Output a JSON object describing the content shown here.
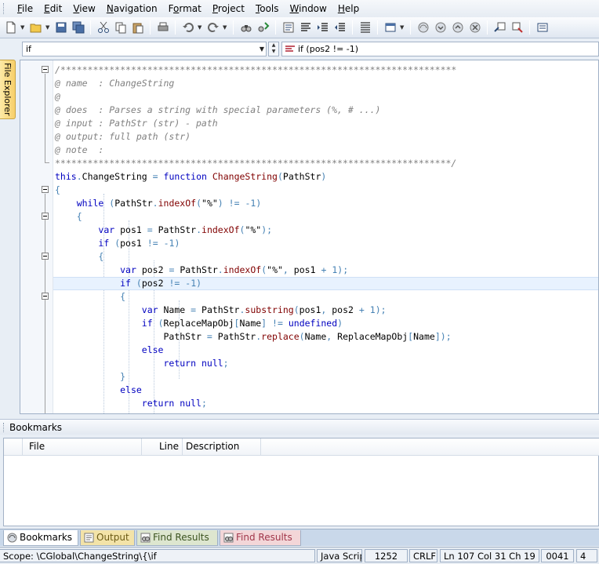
{
  "menu": [
    "File",
    "Edit",
    "View",
    "Navigation",
    "Format",
    "Project",
    "Tools",
    "Window",
    "Help"
  ],
  "menu_underline": [
    "F",
    "E",
    "V",
    "N",
    "o",
    "P",
    "T",
    "W",
    "H"
  ],
  "scope": {
    "combo_value": "if",
    "function_value": "if (pos2 != -1)"
  },
  "side_tab": "File Explorer",
  "code_lines": [
    "/*************************************************************************",
    "@ name  : ChangeString",
    "@",
    "@ does  : Parses a string with special parameters (%, # ...)",
    "@ input : PathStr (str) - path",
    "@ output: full path (str)",
    "@ note  :",
    "*************************************************************************/",
    "this.ChangeString = function ChangeString(PathStr)",
    "{",
    "    while (PathStr.indexOf(\"%\") != -1)",
    "    {",
    "        var pos1 = PathStr.indexOf(\"%\");",
    "        if (pos1 != -1)",
    "        {",
    "            var pos2 = PathStr.indexOf(\"%\", pos1 + 1);",
    "            if (pos2 != -1)",
    "            {",
    "                var Name = PathStr.substring(pos1, pos2 + 1);",
    "                if (ReplaceMapObj[Name] != undefined)",
    "                    PathStr = PathStr.replace(Name, ReplaceMapObj[Name]);",
    "                else",
    "                    return null;",
    "            }",
    "            else",
    "                return null;"
  ],
  "bookmarks": {
    "title": "Bookmarks",
    "columns": [
      "File",
      "Line",
      "Description"
    ]
  },
  "tabs": [
    "Bookmarks",
    "Output",
    "Find Results 1",
    "Find Results 2"
  ],
  "status": {
    "scope": "Scope: \\CGlobal\\ChangeString\\{\\if",
    "language": "Java Script",
    "number": "1252",
    "line_ending": "CRLF",
    "position": "Ln 107 Col 31 Ch 19",
    "code": "0041",
    "extra": "4"
  },
  "colors": {
    "keyword": "#0000c0",
    "function": "#800000",
    "comment": "#808080",
    "operator": "#4682b4"
  }
}
